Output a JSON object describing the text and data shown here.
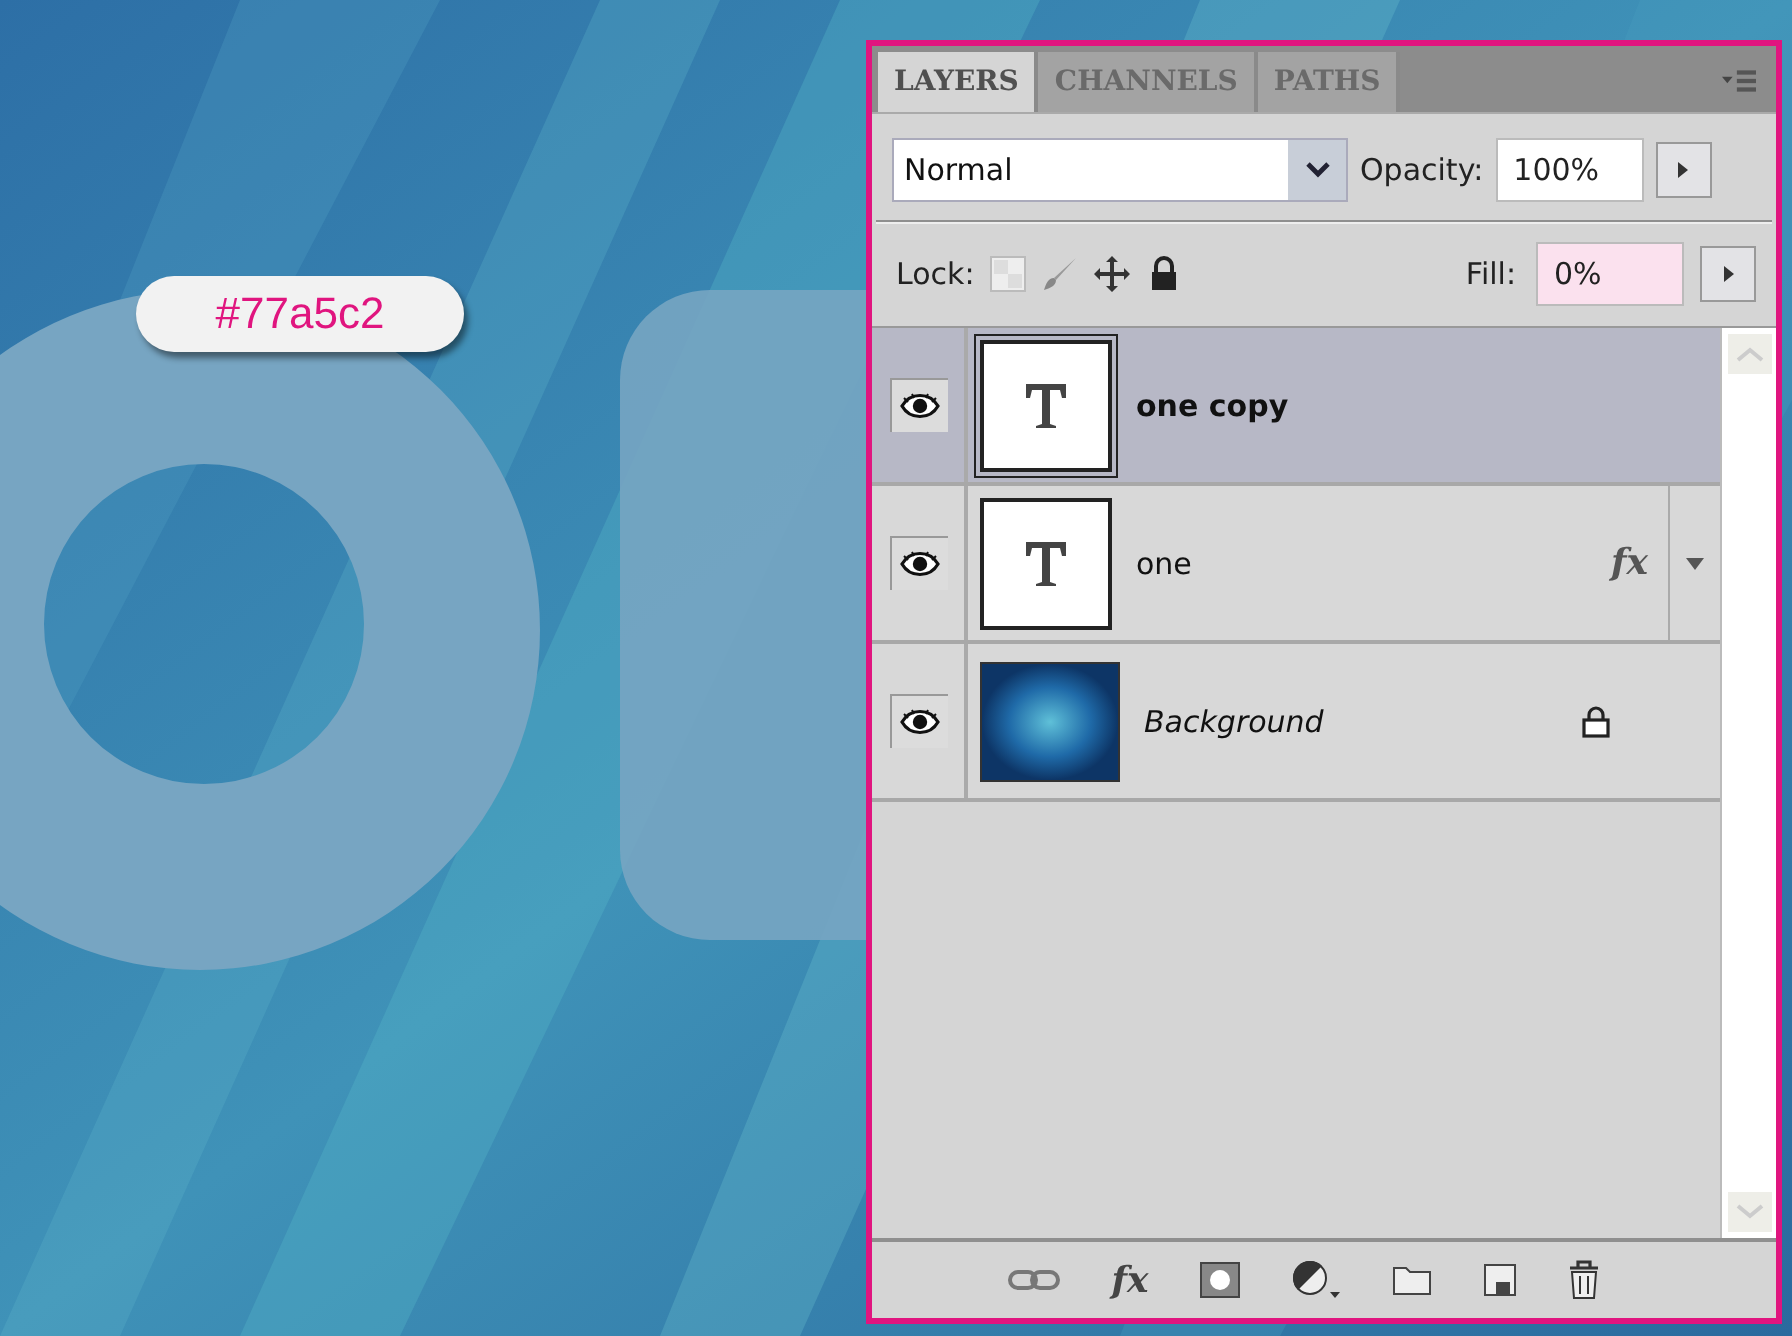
{
  "annotation": {
    "text": "#77a5c2"
  },
  "panel": {
    "tabs": [
      {
        "label": "LAYERS",
        "selected": true
      },
      {
        "label": "CHANNELS",
        "selected": false
      },
      {
        "label": "PATHS",
        "selected": false
      }
    ],
    "blend_mode": {
      "value": "Normal"
    },
    "opacity": {
      "label": "Opacity:",
      "value": "100%"
    },
    "lock": {
      "label": "Lock:"
    },
    "fill": {
      "label": "Fill:",
      "value": "0%",
      "highlighted": true
    },
    "layers": [
      {
        "name": "one copy",
        "kind": "text",
        "selected": true,
        "visible": true,
        "effects": false,
        "locked": false
      },
      {
        "name": "one",
        "kind": "text",
        "selected": false,
        "visible": true,
        "effects": true,
        "effects_badge": "fx",
        "locked": false
      },
      {
        "name": "Background",
        "kind": "background",
        "selected": false,
        "visible": true,
        "effects": false,
        "locked": true
      }
    ],
    "toolbar": [
      {
        "kind": "link"
      },
      {
        "kind": "fx",
        "label": "fx"
      },
      {
        "kind": "mask"
      },
      {
        "kind": "adjustment"
      },
      {
        "kind": "folder"
      },
      {
        "kind": "new"
      },
      {
        "kind": "trash"
      }
    ]
  }
}
